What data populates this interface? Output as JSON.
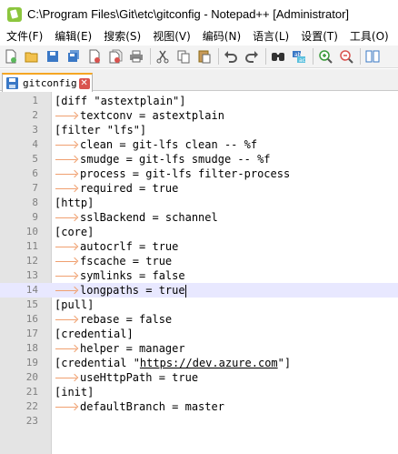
{
  "window": {
    "title": "C:\\Program Files\\Git\\etc\\gitconfig - Notepad++ [Administrator]"
  },
  "menu": [
    "文件(F)",
    "编辑(E)",
    "搜索(S)",
    "视图(V)",
    "编码(N)",
    "语言(L)",
    "设置(T)",
    "工具(O)"
  ],
  "toolbar": {
    "icons": [
      "new-file-icon",
      "open-file-icon",
      "save-icon",
      "save-all-icon",
      "close-icon",
      "close-all-icon",
      "print-icon",
      "cut-icon",
      "copy-icon",
      "paste-icon",
      "undo-icon",
      "redo-icon",
      "find-icon",
      "replace-icon",
      "zoom-in-icon",
      "zoom-out-icon",
      "sync-scroll-icon"
    ]
  },
  "tab": {
    "label": "gitconfig",
    "close": "✕"
  },
  "editor": {
    "current_line": 14,
    "lines": [
      {
        "num": "1",
        "indent": false,
        "text": "[diff \"astextplain\"]"
      },
      {
        "num": "2",
        "indent": true,
        "text": "textconv = astextplain"
      },
      {
        "num": "3",
        "indent": false,
        "text": "[filter \"lfs\"]"
      },
      {
        "num": "4",
        "indent": true,
        "text": "clean = git-lfs clean -- %f"
      },
      {
        "num": "5",
        "indent": true,
        "text": "smudge = git-lfs smudge -- %f"
      },
      {
        "num": "6",
        "indent": true,
        "text": "process = git-lfs filter-process"
      },
      {
        "num": "7",
        "indent": true,
        "text": "required = true"
      },
      {
        "num": "8",
        "indent": false,
        "text": "[http]"
      },
      {
        "num": "9",
        "indent": true,
        "text": "sslBackend = schannel"
      },
      {
        "num": "10",
        "indent": false,
        "text": "[core]"
      },
      {
        "num": "11",
        "indent": true,
        "text": "autocrlf = true"
      },
      {
        "num": "12",
        "indent": true,
        "text": "fscache = true"
      },
      {
        "num": "13",
        "indent": true,
        "text": "symlinks = false"
      },
      {
        "num": "14",
        "indent": true,
        "text": "longpaths = true"
      },
      {
        "num": "15",
        "indent": false,
        "text": "[pull]"
      },
      {
        "num": "16",
        "indent": true,
        "text": "rebase = false"
      },
      {
        "num": "17",
        "indent": false,
        "text": "[credential]"
      },
      {
        "num": "18",
        "indent": true,
        "text": "helper = manager"
      },
      {
        "num": "19",
        "indent": false,
        "text": "[credential \"https://dev.azure.com\"]"
      },
      {
        "num": "20",
        "indent": true,
        "text": "useHttpPath = true"
      },
      {
        "num": "21",
        "indent": false,
        "text": "[init]"
      },
      {
        "num": "22",
        "indent": true,
        "text": "defaultBranch = master"
      },
      {
        "num": "23",
        "indent": false,
        "text": ""
      }
    ]
  },
  "colors": {
    "tab_accent": "#f5a623",
    "gutter": "#e4e4e4",
    "current_line": "#e8e8ff",
    "tab_arrow": "#f0a070",
    "line_number": "#808080"
  }
}
